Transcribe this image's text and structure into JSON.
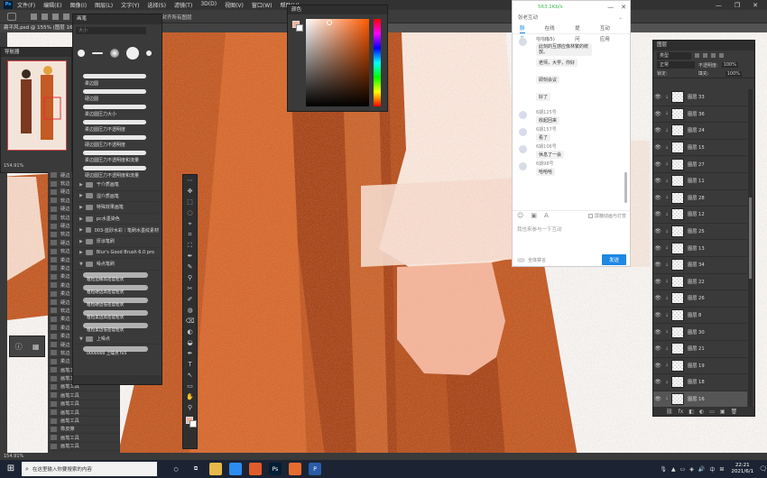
{
  "app": {
    "logo": "Ps",
    "menus": [
      "文件(F)",
      "编辑(E)",
      "图像(I)",
      "图层(L)",
      "文字(Y)",
      "选择(S)",
      "滤镜(T)",
      "3D(D)",
      "视图(V)",
      "窗口(W)",
      "帮助(H)"
    ],
    "window_controls": [
      "—",
      "❐",
      "✕"
    ]
  },
  "options_bar": {
    "label": "5对齐所有图层"
  },
  "document": {
    "tab_title": "扁平风.psd @ 155% (图层 16, RGB/8#) *"
  },
  "navigator": {
    "title": "导航器",
    "zoom": "154.91%"
  },
  "left_brush_list": {
    "labels": [
      "硬边",
      "软边",
      "硬边",
      "软边",
      "硬边",
      "软边",
      "硬边",
      "软边",
      "硬边",
      "软边",
      "柔边",
      "柔边",
      "柔边",
      "柔边",
      "柔边",
      "硬边",
      "软边",
      "柔边",
      "柔边",
      "柔边",
      "硬边",
      "软边",
      "柔边",
      "画笔工具",
      "画笔工具",
      "画笔工具",
      "画笔工具",
      "画笔工具",
      "画笔工具",
      "画笔工具",
      "橡皮擦",
      "画笔工具",
      "画笔工具"
    ]
  },
  "brushes_panel": {
    "title": "画笔",
    "search_placeholder": "大小",
    "strokes": [
      {
        "label": "柔边圆"
      },
      {
        "label": "硬边圆"
      },
      {
        "label": "柔边圆压力大小"
      },
      {
        "label": "柔边圆压力不透明度"
      },
      {
        "label": "硬边圆压力不透明度"
      },
      {
        "label": "柔边圆压力不透明度和流量"
      },
      {
        "label": "硬边圆压力不透明度和流量"
      }
    ],
    "folders": [
      {
        "label": "干介质画笔",
        "arrow": "▶"
      },
      {
        "label": "湿介质画笔",
        "arrow": "▶"
      },
      {
        "label": "特殊效果画笔",
        "arrow": "▶"
      },
      {
        "label": "pc水墨染色",
        "arrow": "▶"
      },
      {
        "label": "003-蓝砂水彩｜笔刷水墨纹素材",
        "arrow": "▶"
      },
      {
        "label": "厚涂笔刷",
        "arrow": "▶"
      },
      {
        "label": "Blur's Good Brush 6.0 pro",
        "arrow": "▶"
      },
      {
        "label": "噪点笔刷",
        "arrow": "▼"
      }
    ],
    "rough_strokes": [
      {
        "label": "粗粒边缘高密度粒状"
      },
      {
        "label": "粗粒硬边高密度粒状"
      },
      {
        "label": "粗粒硬边低密度粒状"
      },
      {
        "label": "粗粒柔边高密度粒状"
      },
      {
        "label": "粗粒柔边低密度粒状"
      }
    ],
    "last_folder": {
      "label": "上噪点",
      "arrow": "▼"
    },
    "last_stroke": {
      "label": "0000000 上噪点 fx5"
    }
  },
  "toolbar": {
    "tools": [
      "⋯",
      "✥",
      "⬚",
      "◌",
      "⌖",
      "⌗",
      "⛶",
      "✒",
      "✎",
      "⚲",
      "✂",
      "✐",
      "◍",
      "⌫",
      "◐",
      "◒",
      "✒",
      "T",
      "↖",
      "▭",
      "✋",
      "⚲",
      "⋯"
    ]
  },
  "color_panel": {
    "title": "颜色",
    "foreground": "#f0b39a",
    "background": "#ffffff"
  },
  "chat": {
    "signal": "563.1Kb/s",
    "title": "张老互动",
    "tabs": [
      {
        "label": "聊天",
        "active": true
      },
      {
        "label": "在线(55)",
        "active": false
      },
      {
        "label": "提问",
        "active": false
      },
      {
        "label": "互动应用",
        "active": false
      }
    ],
    "messages": [
      {
        "name": "喵喵喵",
        "text": "此刻的互感应像林繁的统放。",
        "tall": true
      },
      {
        "name": "",
        "text": "老师，大学，你好",
        "plain": true
      },
      {
        "name": "",
        "text": "即刻会议",
        "plain": true
      },
      {
        "name": "",
        "text": "好了",
        "plain": true
      },
      {
        "name": "6期125号",
        "text": "收起回来"
      },
      {
        "name": "6期157号",
        "text": "看了"
      },
      {
        "name": "6期106号",
        "text": "休息了一会"
      },
      {
        "name": "6期98号",
        "text": "哈哈哈"
      }
    ],
    "tools_icons": [
      "☺",
      "▣",
      "A"
    ],
    "only_teacher_label": "屏蔽动画与打赏",
    "input_placeholder": "我也来参与一下互动",
    "mute_label": "全体禁言",
    "send_label": "发送"
  },
  "layers": {
    "title": "图层",
    "filter_label": "类型",
    "blend_mode": "正常",
    "opacity_label": "不透明度:",
    "opacity_value": "100%",
    "lock_label": "锁定:",
    "fill_label": "填充:",
    "fill_value": "100%",
    "items": [
      {
        "name": "图层 33",
        "selected": false
      },
      {
        "name": "图层 36",
        "selected": false
      },
      {
        "name": "图层 24",
        "selected": false
      },
      {
        "name": "图层 15",
        "selected": false
      },
      {
        "name": "图层 27",
        "selected": false
      },
      {
        "name": "图层 11",
        "selected": false
      },
      {
        "name": "图层 28",
        "selected": false
      },
      {
        "name": "图层 12",
        "selected": false
      },
      {
        "name": "图层 25",
        "selected": false
      },
      {
        "name": "图层 13",
        "selected": false
      },
      {
        "name": "图层 34",
        "selected": false
      },
      {
        "name": "图层 22",
        "selected": false
      },
      {
        "name": "图层 26",
        "selected": false
      },
      {
        "name": "图层 8",
        "selected": false
      },
      {
        "name": "图层 30",
        "selected": false
      },
      {
        "name": "图层 21",
        "selected": false
      },
      {
        "name": "图层 19",
        "selected": false
      },
      {
        "name": "图层 18",
        "selected": false
      },
      {
        "name": "图层 16",
        "selected": true
      }
    ],
    "footer_icons": [
      "⛓",
      "fx",
      "◧",
      "◐",
      "▭",
      "▣",
      "🗑"
    ]
  },
  "status": {
    "zoom": "154.91%"
  },
  "taskbar": {
    "search_placeholder": "在这里输入你要搜索的内容",
    "apps": [
      {
        "label": "○",
        "color": "#1c2433"
      },
      {
        "label": "⧉",
        "color": "#1c2433"
      },
      {
        "label": "",
        "color": "#e8b84a"
      },
      {
        "label": "",
        "color": "#2d8cf0"
      },
      {
        "label": "",
        "color": "#e25b2b"
      },
      {
        "label": "Ps",
        "color": "#001e36"
      },
      {
        "label": "",
        "color": "#e56b2f"
      },
      {
        "label": "P",
        "color": "#2a5ca8"
      }
    ],
    "tray_icons": [
      "🎙",
      "▲",
      "▭",
      "◈",
      "🔊",
      "中",
      "⊞"
    ],
    "time": "22:21",
    "date": "2021/6/1",
    "notify_icon": "🗨"
  }
}
